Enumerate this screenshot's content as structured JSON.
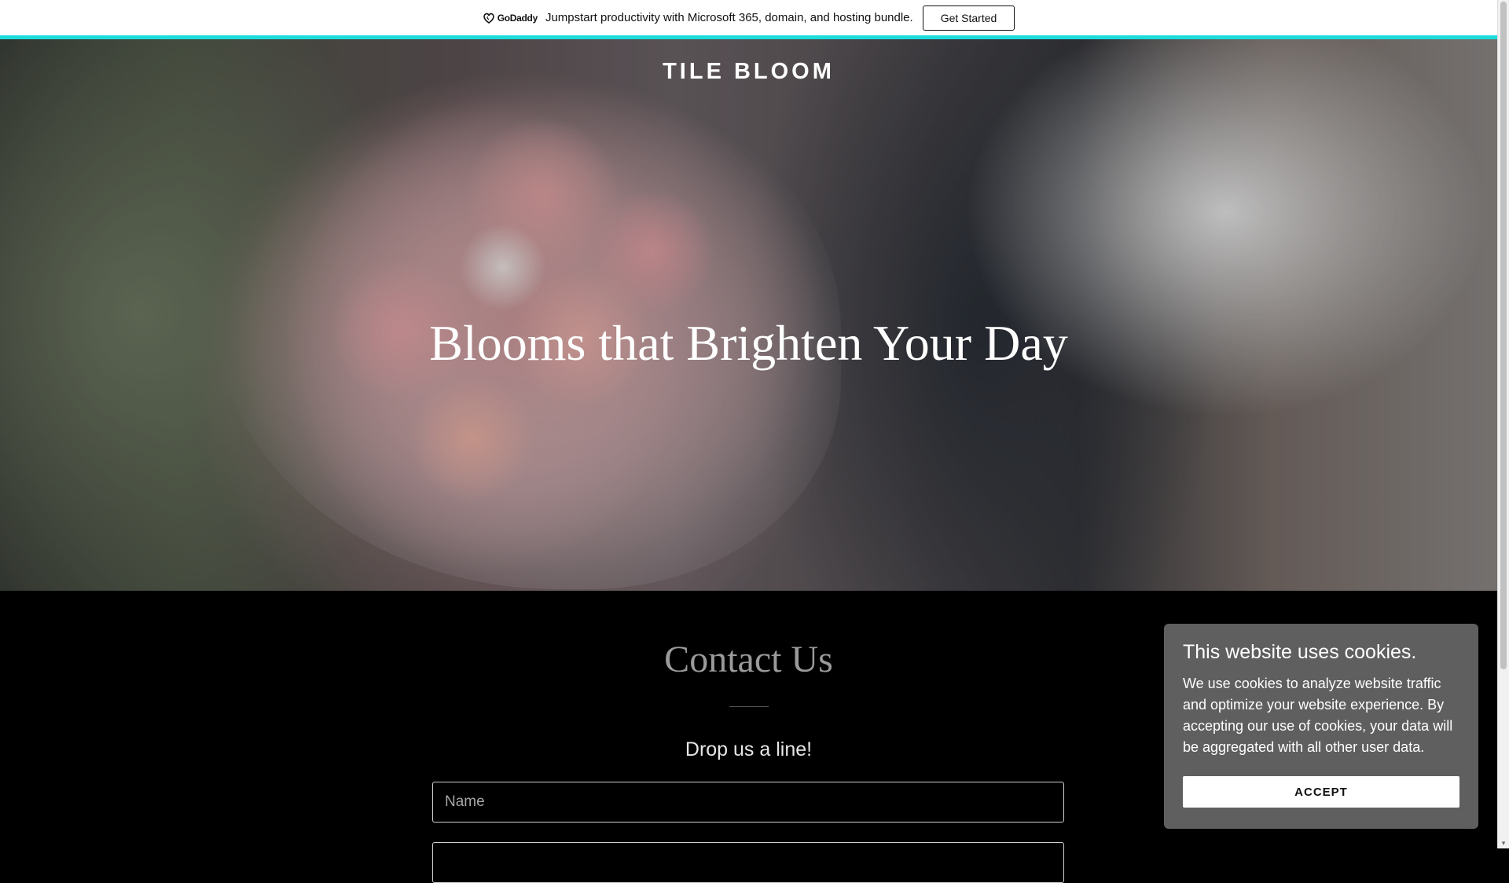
{
  "promo": {
    "brand": "GoDaddy",
    "text": "Jumpstart productivity with Microsoft 365, domain, and hosting bundle.",
    "button": "Get Started",
    "accent": "#1bdbdb"
  },
  "hero": {
    "brand": "TILE BLOOM",
    "title": "Blooms that Brighten Your Day"
  },
  "contact": {
    "title": "Contact Us",
    "subtitle": "Drop us a line!",
    "name_placeholder": "Name",
    "email_placeholder": ""
  },
  "cookie": {
    "title": "This website uses cookies.",
    "text": "We use cookies to analyze website traffic and optimize your website experience. By accepting our use of cookies, your data will be aggregated with all other user data.",
    "button": "ACCEPT"
  },
  "colors": {
    "background": "#000000",
    "cookie_bg": "#5f5f5f"
  }
}
